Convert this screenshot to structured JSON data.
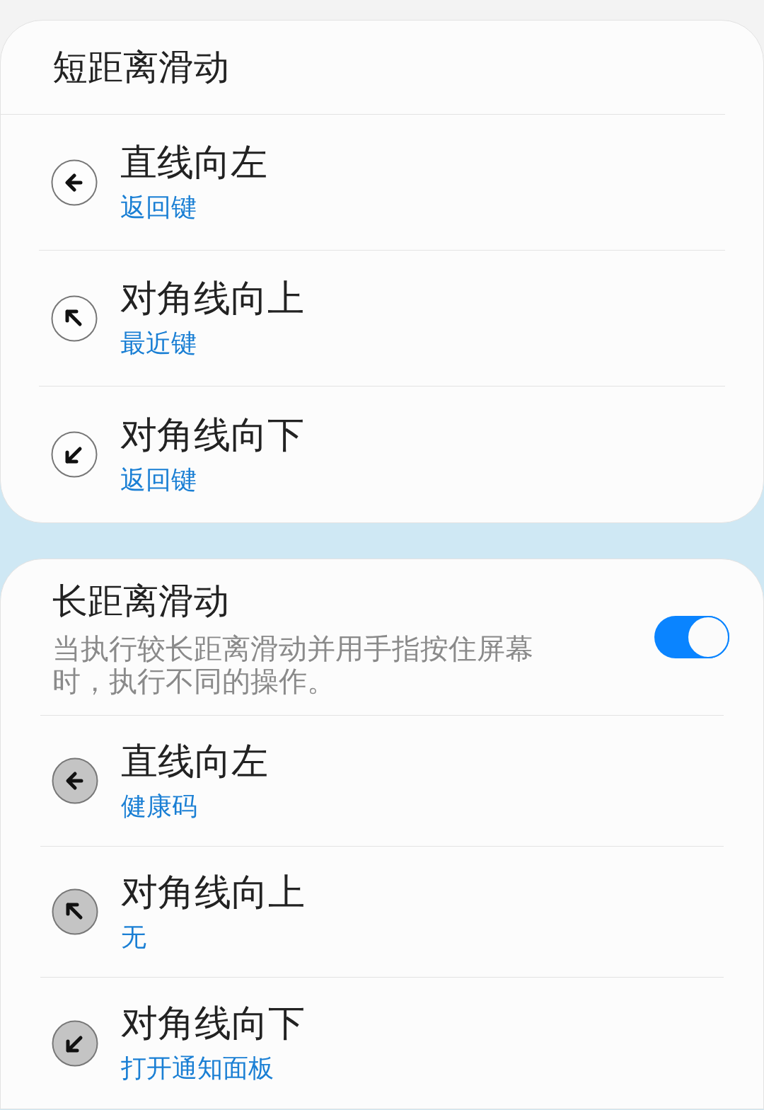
{
  "sections": [
    {
      "title": "短距离滑动",
      "kind": "outline",
      "items": [
        {
          "kind": "left",
          "title": "直线向左",
          "action": "返回键"
        },
        {
          "kind": "up-left",
          "title": "对角线向上",
          "action": "最近键"
        },
        {
          "kind": "down-left",
          "title": "对角线向下",
          "action": "返回键"
        }
      ]
    },
    {
      "title": "长距离滑动",
      "description": "当执行较长距离滑动并用手指按住屏幕时，执行不同的操作。",
      "toggle": {
        "on": true
      },
      "kind": "filled",
      "items": [
        {
          "kind": "left",
          "title": "直线向左",
          "action": "健康码"
        },
        {
          "kind": "up-left",
          "title": "对角线向上",
          "action": "无"
        },
        {
          "kind": "down-left",
          "title": "对角线向下",
          "action": "打开通知面板"
        }
      ]
    }
  ]
}
